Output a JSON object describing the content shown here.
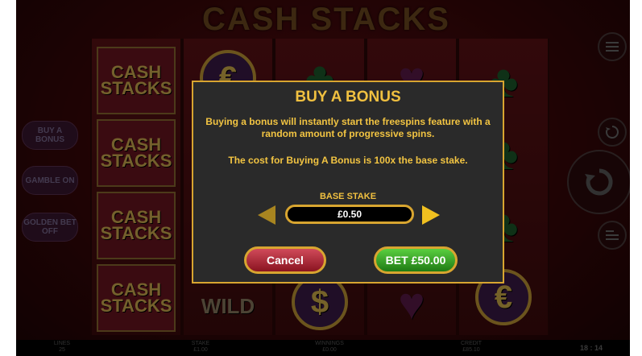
{
  "game": {
    "title": "CASH STACKS"
  },
  "reel_symbols": {
    "cash_stacks": "CASH STACKS",
    "euro": "€",
    "club": "♣",
    "heart": "♥",
    "wild": "WILD",
    "dollar": "$"
  },
  "left_controls": {
    "buy_bonus": "BUY A BONUS",
    "gamble": "GAMBLE ON",
    "golden_bet": "GOLDEN BET OFF"
  },
  "bottom_bar": {
    "lines_label": "LINES",
    "lines_value": "25",
    "stake_label": "STAKE",
    "stake_value": "£1.00",
    "winnings_label": "WINNINGS",
    "winnings_value": "£0.00",
    "credit_label": "CREDIT",
    "credit_value": "£85.10",
    "clock": "18 : 14"
  },
  "dialog": {
    "title": "BUY A BONUS",
    "description": "Buying a bonus will instantly start the freespins feature with a random amount of progressive spins.",
    "cost_text": "The cost for Buying A Bonus is 100x the base stake.",
    "base_stake_label": "BASE STAKE",
    "base_stake_value": "£0.50",
    "cancel_label": "Cancel",
    "bet_label": "BET £50.00"
  },
  "icons": [
    "menu-icon",
    "autoplay-icon",
    "spin-icon",
    "paytable-icon",
    "arrow-left-icon",
    "arrow-right-icon"
  ],
  "colors": {
    "accent_gold": "#d8a530",
    "title_gold": "#f0c040",
    "cancel_red": "#b02a3a",
    "bet_green": "#2f9a20",
    "dialog_bg": "#2a2a2a"
  }
}
